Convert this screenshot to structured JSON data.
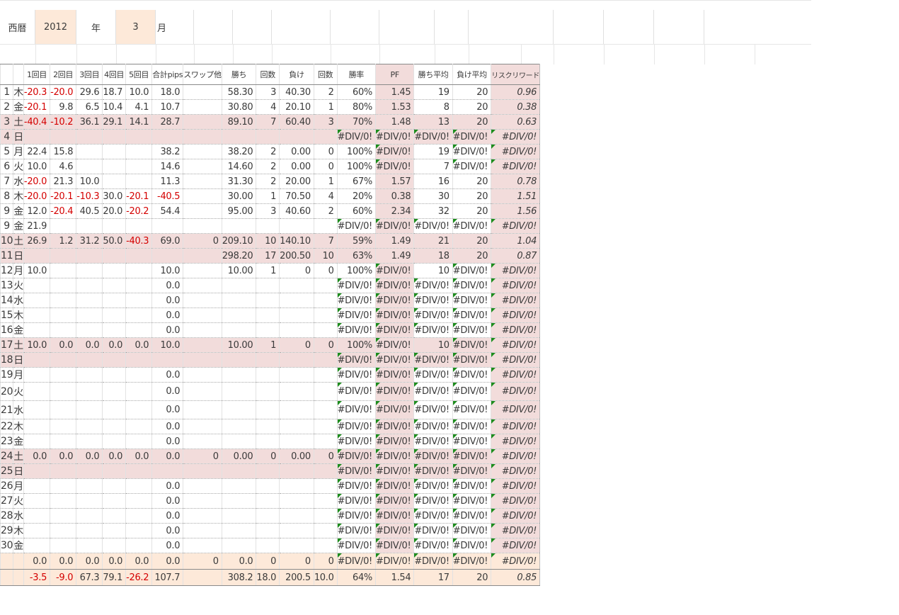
{
  "header": {
    "era_label": "西暦",
    "year": "2012",
    "year_unit": "年",
    "month": "3",
    "month_unit": "月"
  },
  "columns": [
    "",
    "",
    "1回目",
    "2回目",
    "3回目",
    "4回目",
    "5回目",
    "合計pips",
    "スワップ他",
    "勝ち",
    "回数",
    "負け",
    "回数",
    "勝率",
    "PF",
    "勝ち平均",
    "負け平均",
    "リスクリワード"
  ],
  "rows": [
    {
      "c": [
        "1",
        "木",
        "-20.3",
        "-20.0",
        "29.6",
        "18.7",
        "10.0",
        "18.0",
        "",
        "58.30",
        "3",
        "40.30",
        "2",
        "60%",
        "1.45",
        "19",
        "20",
        "0.96"
      ],
      "pink": false
    },
    {
      "c": [
        "2",
        "金",
        "-20.1",
        "9.8",
        "6.5",
        "10.4",
        "4.1",
        "10.7",
        "",
        "30.80",
        "4",
        "20.10",
        "1",
        "80%",
        "1.53",
        "8",
        "20",
        "0.38"
      ],
      "pink": false
    },
    {
      "c": [
        "3",
        "土",
        "-40.4",
        "-10.2",
        "36.1",
        "29.1",
        "14.1",
        "28.7",
        "",
        "89.10",
        "7",
        "60.40",
        "3",
        "70%",
        "1.48",
        "13",
        "20",
        "0.63"
      ],
      "pink": true
    },
    {
      "c": [
        "4",
        "日",
        "",
        "",
        "",
        "",
        "",
        "",
        "",
        "",
        "",
        "",
        "",
        "#DIV/0!",
        "#DIV/0!",
        "#DIV/0!",
        "#DIV/0!",
        "#DIV/0!"
      ],
      "pink": true
    },
    {
      "c": [
        "5",
        "月",
        "22.4",
        "15.8",
        "",
        "",
        "",
        "38.2",
        "",
        "38.20",
        "2",
        "0.00",
        "0",
        "100%",
        "#DIV/0!",
        "19",
        "#DIV/0!",
        "#DIV/0!"
      ],
      "pink": false
    },
    {
      "c": [
        "6",
        "火",
        "10.0",
        "4.6",
        "",
        "",
        "",
        "14.6",
        "",
        "14.60",
        "2",
        "0.00",
        "0",
        "100%",
        "#DIV/0!",
        "7",
        "#DIV/0!",
        "#DIV/0!"
      ],
      "pink": false
    },
    {
      "c": [
        "7",
        "水",
        "-20.0",
        "21.3",
        "10.0",
        "",
        "",
        "11.3",
        "",
        "31.30",
        "2",
        "20.00",
        "1",
        "67%",
        "1.57",
        "16",
        "20",
        "0.78"
      ],
      "pink": false
    },
    {
      "c": [
        "8",
        "木",
        "-20.0",
        "-20.1",
        "-10.3",
        "30.0",
        "-20.1",
        "-40.5",
        "",
        "30.00",
        "1",
        "70.50",
        "4",
        "20%",
        "0.38",
        "30",
        "20",
        "1.51"
      ],
      "pink": false
    },
    {
      "c": [
        "9",
        "金",
        "12.0",
        "-20.4",
        "40.5",
        "20.0",
        "-20.2",
        "54.4",
        "",
        "95.00",
        "3",
        "40.60",
        "2",
        "60%",
        "2.34",
        "32",
        "20",
        "1.56"
      ],
      "pink": false
    },
    {
      "c": [
        "9",
        "金",
        "21.9",
        "",
        "",
        "",
        "",
        "",
        "",
        "",
        "",
        "",
        "",
        "#DIV/0!",
        "#DIV/0!",
        "#DIV/0!",
        "#DIV/0!",
        "#DIV/0!"
      ],
      "pink": false
    },
    {
      "c": [
        "10",
        "土",
        "26.9",
        "1.2",
        "31.2",
        "50.0",
        "-40.3",
        "69.0",
        "0",
        "209.10",
        "10",
        "140.10",
        "7",
        "59%",
        "1.49",
        "21",
        "20",
        "1.04"
      ],
      "pink": true
    },
    {
      "c": [
        "11",
        "日",
        "",
        "",
        "",
        "",
        "",
        "",
        "",
        "298.20",
        "17",
        "200.50",
        "10",
        "63%",
        "1.49",
        "18",
        "20",
        "0.87"
      ],
      "pink": true
    },
    {
      "c": [
        "12",
        "月",
        "10.0",
        "",
        "",
        "",
        "",
        "10.0",
        "",
        "10.00",
        "1",
        "0",
        "0",
        "100%",
        "#DIV/0!",
        "10",
        "#DIV/0!",
        "#DIV/0!"
      ],
      "pink": false
    },
    {
      "c": [
        "13",
        "火",
        "",
        "",
        "",
        "",
        "",
        "0.0",
        "",
        "",
        "",
        "",
        "",
        "#DIV/0!",
        "#DIV/0!",
        "#DIV/0!",
        "#DIV/0!",
        "#DIV/0!"
      ],
      "pink": false
    },
    {
      "c": [
        "14",
        "水",
        "",
        "",
        "",
        "",
        "",
        "0.0",
        "",
        "",
        "",
        "",
        "",
        "#DIV/0!",
        "#DIV/0!",
        "#DIV/0!",
        "#DIV/0!",
        "#DIV/0!"
      ],
      "pink": false
    },
    {
      "c": [
        "15",
        "木",
        "",
        "",
        "",
        "",
        "",
        "0.0",
        "",
        "",
        "",
        "",
        "",
        "#DIV/0!",
        "#DIV/0!",
        "#DIV/0!",
        "#DIV/0!",
        "#DIV/0!"
      ],
      "pink": false
    },
    {
      "c": [
        "16",
        "金",
        "",
        "",
        "",
        "",
        "",
        "0.0",
        "",
        "",
        "",
        "",
        "",
        "#DIV/0!",
        "#DIV/0!",
        "#DIV/0!",
        "#DIV/0!",
        "#DIV/0!"
      ],
      "pink": false
    },
    {
      "c": [
        "17",
        "土",
        "10.0",
        "0.0",
        "0.0",
        "0.0",
        "0.0",
        "10.0",
        "",
        "10.00",
        "1",
        "0",
        "0",
        "100%",
        "#DIV/0!",
        "10",
        "#DIV/0!",
        "#DIV/0!"
      ],
      "pink": true
    },
    {
      "c": [
        "18",
        "日",
        "",
        "",
        "",
        "",
        "",
        "",
        "",
        "",
        "",
        "",
        "",
        "#DIV/0!",
        "#DIV/0!",
        "#DIV/0!",
        "#DIV/0!",
        "#DIV/0!"
      ],
      "pink": true
    },
    {
      "c": [
        "19",
        "月",
        "",
        "",
        "",
        "",
        "",
        "0.0",
        "",
        "",
        "",
        "",
        "",
        "#DIV/0!",
        "#DIV/0!",
        "#DIV/0!",
        "#DIV/0!",
        "#DIV/0!"
      ],
      "pink": false
    },
    {
      "c": [
        "20",
        "火",
        "",
        "",
        "",
        "",
        "",
        "0.0",
        "",
        "",
        "",
        "",
        "",
        "#DIV/0!",
        "#DIV/0!",
        "#DIV/0!",
        "#DIV/0!",
        "#DIV/0!"
      ],
      "pink": false,
      "tall": true
    },
    {
      "c": [
        "21",
        "水",
        "",
        "",
        "",
        "",
        "",
        "0.0",
        "",
        "",
        "",
        "",
        "",
        "#DIV/0!",
        "#DIV/0!",
        "#DIV/0!",
        "#DIV/0!",
        "#DIV/0!"
      ],
      "pink": false,
      "tall": true
    },
    {
      "c": [
        "22",
        "木",
        "",
        "",
        "",
        "",
        "",
        "0.0",
        "",
        "",
        "",
        "",
        "",
        "#DIV/0!",
        "#DIV/0!",
        "#DIV/0!",
        "#DIV/0!",
        "#DIV/0!"
      ],
      "pink": false
    },
    {
      "c": [
        "23",
        "金",
        "",
        "",
        "",
        "",
        "",
        "0.0",
        "",
        "",
        "",
        "",
        "",
        "#DIV/0!",
        "#DIV/0!",
        "#DIV/0!",
        "#DIV/0!",
        "#DIV/0!"
      ],
      "pink": false
    },
    {
      "c": [
        "24",
        "土",
        "0.0",
        "0.0",
        "0.0",
        "0.0",
        "0.0",
        "0.0",
        "0",
        "0.00",
        "0",
        "0.00",
        "0",
        "#DIV/0!",
        "#DIV/0!",
        "#DIV/0!",
        "#DIV/0!",
        "#DIV/0!"
      ],
      "pink": true
    },
    {
      "c": [
        "25",
        "日",
        "",
        "",
        "",
        "",
        "",
        "",
        "",
        "",
        "",
        "",
        "",
        "#DIV/0!",
        "#DIV/0!",
        "#DIV/0!",
        "#DIV/0!",
        "#DIV/0!"
      ],
      "pink": true
    },
    {
      "c": [
        "26",
        "月",
        "",
        "",
        "",
        "",
        "",
        "0.0",
        "",
        "",
        "",
        "",
        "",
        "#DIV/0!",
        "#DIV/0!",
        "#DIV/0!",
        "#DIV/0!",
        "#DIV/0!"
      ],
      "pink": false
    },
    {
      "c": [
        "27",
        "火",
        "",
        "",
        "",
        "",
        "",
        "0.0",
        "",
        "",
        "",
        "",
        "",
        "#DIV/0!",
        "#DIV/0!",
        "#DIV/0!",
        "#DIV/0!",
        "#DIV/0!"
      ],
      "pink": false
    },
    {
      "c": [
        "28",
        "水",
        "",
        "",
        "",
        "",
        "",
        "0.0",
        "",
        "",
        "",
        "",
        "",
        "#DIV/0!",
        "#DIV/0!",
        "#DIV/0!",
        "#DIV/0!",
        "#DIV/0!"
      ],
      "pink": false
    },
    {
      "c": [
        "29",
        "木",
        "",
        "",
        "",
        "",
        "",
        "0.0",
        "",
        "",
        "",
        "",
        "",
        "#DIV/0!",
        "#DIV/0!",
        "#DIV/0!",
        "#DIV/0!",
        "#DIV/0!"
      ],
      "pink": false
    },
    {
      "c": [
        "30",
        "金",
        "",
        "",
        "",
        "",
        "",
        "0.0",
        "",
        "",
        "",
        "",
        "",
        "#DIV/0!",
        "#DIV/0!",
        "#DIV/0!",
        "#DIV/0!",
        "#DIV/0!"
      ],
      "pink": false
    }
  ],
  "footer": [
    {
      "c": [
        "",
        "",
        "0.0",
        "0.0",
        "0.0",
        "0.0",
        "0.0",
        "0.0",
        "0",
        "0.0",
        "0",
        "0",
        "0",
        "#DIV/0!",
        "#DIV/0!",
        "#DIV/0!",
        "#DIV/0!",
        "#DIV/0!"
      ]
    },
    {
      "c": [
        "",
        "",
        "-3.5",
        "-9.0",
        "67.3",
        "79.1",
        "-26.2",
        "107.7",
        "",
        "308.2",
        "18.0",
        "200.5",
        "10.0",
        "64%",
        "1.54",
        "17",
        "20",
        "0.85"
      ]
    }
  ],
  "colors": {
    "negative": "#d40000",
    "weekend_row": "#f2dcdb",
    "footer_row": "#fde9d9",
    "error_marker": "#1c8c1c"
  }
}
